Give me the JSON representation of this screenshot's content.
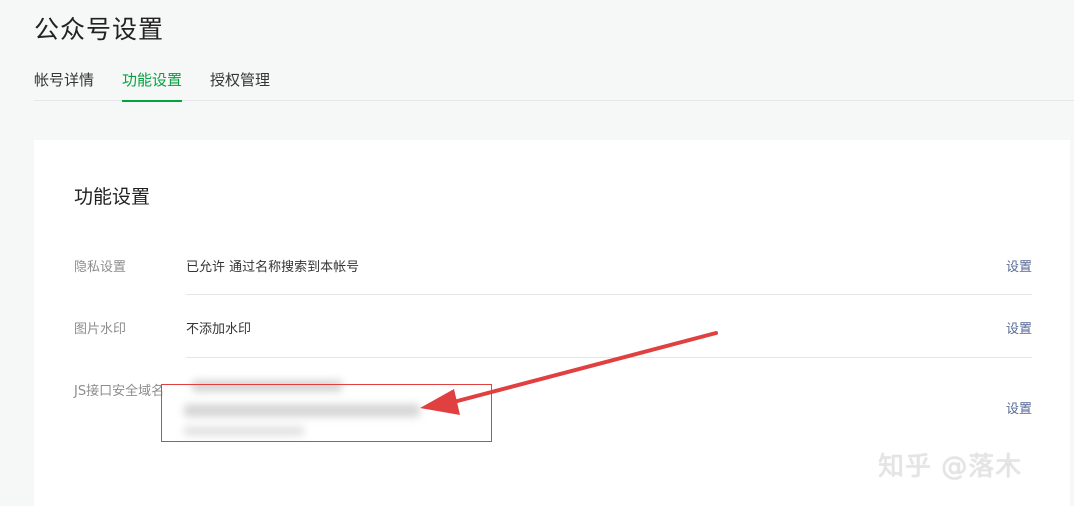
{
  "page": {
    "title": "公众号设置"
  },
  "tabs": [
    {
      "label": "帐号详情",
      "active": false
    },
    {
      "label": "功能设置",
      "active": true
    },
    {
      "label": "授权管理",
      "active": false
    }
  ],
  "section": {
    "title": "功能设置",
    "rows": [
      {
        "label": "隐私设置",
        "value": "已允许 通过名称搜索到本帐号",
        "action": "设置"
      },
      {
        "label": "图片水印",
        "value": "不添加水印",
        "action": "设置"
      },
      {
        "label": "JS接口安全域名",
        "value": "",
        "action": "设置"
      }
    ]
  },
  "watermark": "知乎 @落木",
  "colors": {
    "accent": "#07a240",
    "link": "#576b95",
    "annotation": "#e04040"
  }
}
